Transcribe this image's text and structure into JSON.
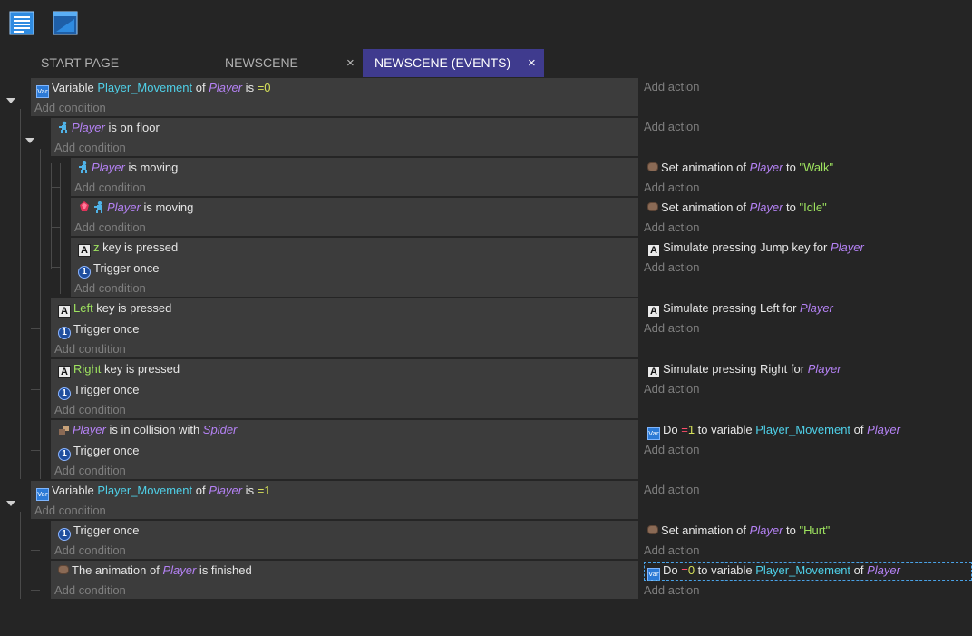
{
  "toolbar": {
    "icons": [
      "events-list-icon",
      "scene-window-icon"
    ]
  },
  "tabs": [
    {
      "label": "START PAGE"
    },
    {
      "label": "NEWSCENE",
      "close": "×"
    },
    {
      "label": "NEWSCENE (EVENTS)",
      "close": "×",
      "active": true
    }
  ],
  "common": {
    "add_condition": "Add condition",
    "add_action": "Add action",
    "var_icon_text": "Var",
    "trigger_icon_text": "1",
    "key_icon_text": "A"
  },
  "events": [
    {
      "conditions": [
        {
          "pre": "Variable ",
          "var": "Player_Movement",
          "mid": " of ",
          "obj": "Player",
          "post": " is ",
          "op": "=",
          "num": "0"
        }
      ],
      "actions": []
    },
    {
      "conditions": [
        {
          "obj": "Player",
          "post": " is on floor"
        }
      ],
      "actions": []
    },
    {
      "conditions": [
        {
          "obj": "Player",
          "post": " is moving"
        }
      ],
      "actions": [
        {
          "pre": "Set animation of ",
          "obj": "Player",
          "mid": " to ",
          "str": "\"Walk\""
        }
      ]
    },
    {
      "conditions": [
        {
          "obj": "Player",
          "post": " is moving"
        }
      ],
      "actions": [
        {
          "pre": "Set animation of ",
          "obj": "Player",
          "mid": " to ",
          "str": "\"Idle\""
        }
      ]
    },
    {
      "conditions": [
        {
          "key": "z",
          "post": " key is pressed"
        },
        {
          "post": "Trigger once"
        }
      ],
      "actions": [
        {
          "pre": "Simulate pressing Jump key for ",
          "obj": "Player"
        }
      ]
    },
    {
      "conditions": [
        {
          "key": "Left",
          "post": " key is pressed"
        },
        {
          "post": "Trigger once"
        }
      ],
      "actions": [
        {
          "pre": "Simulate pressing Left for ",
          "obj": "Player"
        }
      ]
    },
    {
      "conditions": [
        {
          "key": "Right",
          "post": " key is pressed"
        },
        {
          "post": "Trigger once"
        }
      ],
      "actions": [
        {
          "pre": "Simulate pressing Right for ",
          "obj": "Player"
        }
      ]
    },
    {
      "conditions": [
        {
          "obj": "Player",
          "post": " is in collision with ",
          "obj2": "Spider"
        },
        {
          "post": "Trigger once"
        }
      ],
      "actions": [
        {
          "pre": "Do ",
          "op": "=",
          "num": "1",
          "mid": " to variable ",
          "var": "Player_Movement",
          "mid2": " of ",
          "obj": "Player"
        }
      ]
    },
    {
      "conditions": [
        {
          "pre": "Variable ",
          "var": "Player_Movement",
          "mid": " of ",
          "obj": "Player",
          "post": " is ",
          "op": "=",
          "num": "1"
        }
      ],
      "actions": []
    },
    {
      "conditions": [
        {
          "post": "Trigger once"
        }
      ],
      "actions": [
        {
          "pre": "Set animation of ",
          "obj": "Player",
          "mid": " to ",
          "str": "\"Hurt\""
        }
      ]
    },
    {
      "conditions": [
        {
          "pre": "The animation of ",
          "obj": "Player",
          "post": " is finished"
        }
      ],
      "actions": [
        {
          "pre": "Do ",
          "op": "=",
          "num": "0",
          "mid": " to variable ",
          "var": "Player_Movement",
          "mid2": " of ",
          "obj": "Player"
        }
      ]
    }
  ]
}
